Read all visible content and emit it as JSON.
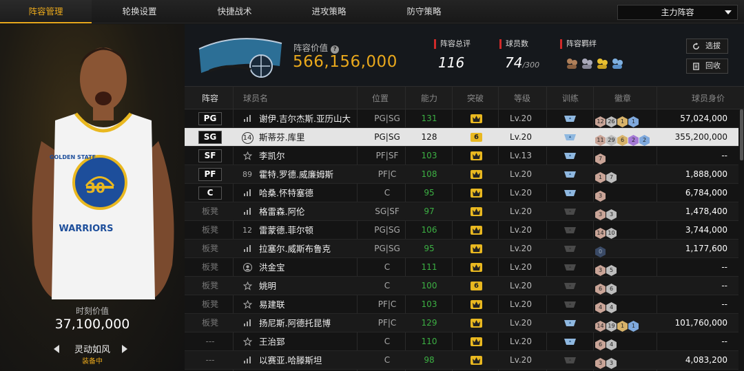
{
  "tabs": [
    "阵容管理",
    "轮换设置",
    "快捷战术",
    "进攻策略",
    "防守策略"
  ],
  "lineup_select": "主力阵容",
  "left": {
    "moment_label": "时刻价值",
    "moment_value": "37,100,000",
    "skill_name": "灵动如风",
    "skill_status": "装备中",
    "jersey_team": "GOLDEN STATE",
    "jersey_number": "30",
    "jersey_name": "WARRIORS"
  },
  "header": {
    "value_label": "阵容价值",
    "value": "566,156,000",
    "rating_label": "阵容总评",
    "rating": "116",
    "count_label": "球员数",
    "count": "74",
    "count_max": "/300",
    "bond_label": "阵容羁绊",
    "btn_pick": "选拔",
    "btn_back": "回收"
  },
  "columns": {
    "lineup": "阵容",
    "player": "球员名",
    "position": "位置",
    "ability": "能力",
    "breakthrough": "突破",
    "level": "等级",
    "training": "训练",
    "badge": "徽章",
    "worth": "球员身价"
  },
  "colors": {
    "accent": "#e9a81c",
    "green": "#3cb043",
    "red_marker": "#d02a2a"
  },
  "rows": [
    {
      "slot": "PG",
      "icon": "bars-icon",
      "num": "",
      "name": "谢伊.吉尔杰斯.亚历山大",
      "pos": "PG|SG",
      "ability": "131",
      "break": "",
      "level": "Lv.20",
      "train": "blue",
      "badges": [
        [
          "12",
          "#c9a497"
        ],
        [
          "26",
          "#bdbdbd"
        ],
        [
          "1",
          "#d8b36a"
        ],
        [
          "1",
          "#7fa9dd"
        ]
      ],
      "worth": "57,024,000"
    },
    {
      "slot": "SG",
      "icon": "circle-num-icon",
      "num": "14",
      "name": "斯蒂芬.库里",
      "pos": "PG|SG",
      "ability": "128",
      "break": "6",
      "level": "Lv.20",
      "train": "blue",
      "badges": [
        [
          "11",
          "#c9a497"
        ],
        [
          "29",
          "#bdbdbd"
        ],
        [
          "6",
          "#d8b36a"
        ],
        [
          "2",
          "#a57ad6"
        ],
        [
          "2",
          "#7fa9dd"
        ]
      ],
      "worth": "355,200,000"
    },
    {
      "slot": "SF",
      "icon": "star-icon",
      "num": "",
      "name": "李凯尔",
      "pos": "PF|SF",
      "ability": "103",
      "break": "",
      "level": "Lv.13",
      "train": "blue",
      "badges": [
        [
          "7",
          "#c9a497"
        ]
      ],
      "worth": "--"
    },
    {
      "slot": "PF",
      "icon": "",
      "num": "89",
      "name": "霍特.罗德.威廉姆斯",
      "pos": "PF|C",
      "ability": "108",
      "break": "",
      "level": "Lv.20",
      "train": "blue",
      "badges": [
        [
          "1",
          "#c9a497"
        ],
        [
          "7",
          "#bdbdbd"
        ]
      ],
      "worth": "1,888,000"
    },
    {
      "slot": "C",
      "icon": "bars-icon",
      "num": "",
      "name": "哈桑.怀特塞德",
      "pos": "C",
      "ability": "95",
      "break": "",
      "level": "Lv.20",
      "train": "blue",
      "badges": [
        [
          "3",
          "#c9a497"
        ]
      ],
      "worth": "6,784,000"
    },
    {
      "slot": "板凳",
      "icon": "bars-icon",
      "num": "",
      "name": "格雷森.阿伦",
      "pos": "SG|SF",
      "ability": "97",
      "break": "",
      "level": "Lv.20",
      "train": "gray",
      "badges": [
        [
          "3",
          "#c9a497"
        ],
        [
          "3",
          "#bdbdbd"
        ]
      ],
      "worth": "1,478,400"
    },
    {
      "slot": "板凳",
      "icon": "",
      "num": "12",
      "name": "雷蒙德.菲尔顿",
      "pos": "PG|SG",
      "ability": "106",
      "break": "",
      "level": "Lv.20",
      "train": "gray",
      "badges": [
        [
          "14",
          "#c9a497"
        ],
        [
          "10",
          "#bdbdbd"
        ]
      ],
      "worth": "3,744,000"
    },
    {
      "slot": "板凳",
      "icon": "bars-icon",
      "num": "",
      "name": "拉塞尔.威斯布鲁克",
      "pos": "PG|SG",
      "ability": "95",
      "break": "",
      "level": "Lv.20",
      "train": "gray",
      "badges": [
        [
          "0",
          "#3a4a66"
        ]
      ],
      "worth": "1,177,600"
    },
    {
      "slot": "板凳",
      "icon": "person-icon",
      "num": "",
      "name": "洪金宝",
      "pos": "C",
      "ability": "111",
      "break": "",
      "level": "Lv.20",
      "train": "gray",
      "badges": [
        [
          "3",
          "#c9a497"
        ],
        [
          "5",
          "#bdbdbd"
        ]
      ],
      "worth": "--"
    },
    {
      "slot": "板凳",
      "icon": "star-icon",
      "num": "",
      "name": "姚明",
      "pos": "C",
      "ability": "100",
      "break": "6",
      "level": "Lv.20",
      "train": "gray",
      "badges": [
        [
          "6",
          "#c9a497"
        ],
        [
          "6",
          "#bdbdbd"
        ]
      ],
      "worth": "--"
    },
    {
      "slot": "板凳",
      "icon": "star-icon",
      "num": "",
      "name": "易建联",
      "pos": "PF|C",
      "ability": "103",
      "break": "",
      "level": "Lv.20",
      "train": "gray",
      "badges": [
        [
          "4",
          "#c9a497"
        ],
        [
          "4",
          "#bdbdbd"
        ]
      ],
      "worth": "--"
    },
    {
      "slot": "板凳",
      "icon": "bars-icon",
      "num": "",
      "name": "扬尼斯.阿德托昆博",
      "pos": "PF|C",
      "ability": "129",
      "break": "",
      "level": "Lv.20",
      "train": "blue",
      "badges": [
        [
          "14",
          "#c9a497"
        ],
        [
          "19",
          "#bdbdbd"
        ],
        [
          "1",
          "#d8b36a"
        ],
        [
          "1",
          "#7fa9dd"
        ]
      ],
      "worth": "101,760,000"
    },
    {
      "slot": "---",
      "icon": "star-icon",
      "num": "",
      "name": "王治郅",
      "pos": "C",
      "ability": "110",
      "break": "",
      "level": "Lv.20",
      "train": "blue",
      "badges": [
        [
          "6",
          "#c9a497"
        ],
        [
          "4",
          "#bdbdbd"
        ]
      ],
      "worth": "--"
    },
    {
      "slot": "---",
      "icon": "bars-icon",
      "num": "",
      "name": "以赛亚.哈滕斯坦",
      "pos": "C",
      "ability": "98",
      "break": "",
      "level": "Lv.20",
      "train": "gray",
      "badges": [
        [
          "3",
          "#c9a497"
        ],
        [
          "3",
          "#bdbdbd"
        ]
      ],
      "worth": "4,083,200"
    }
  ]
}
